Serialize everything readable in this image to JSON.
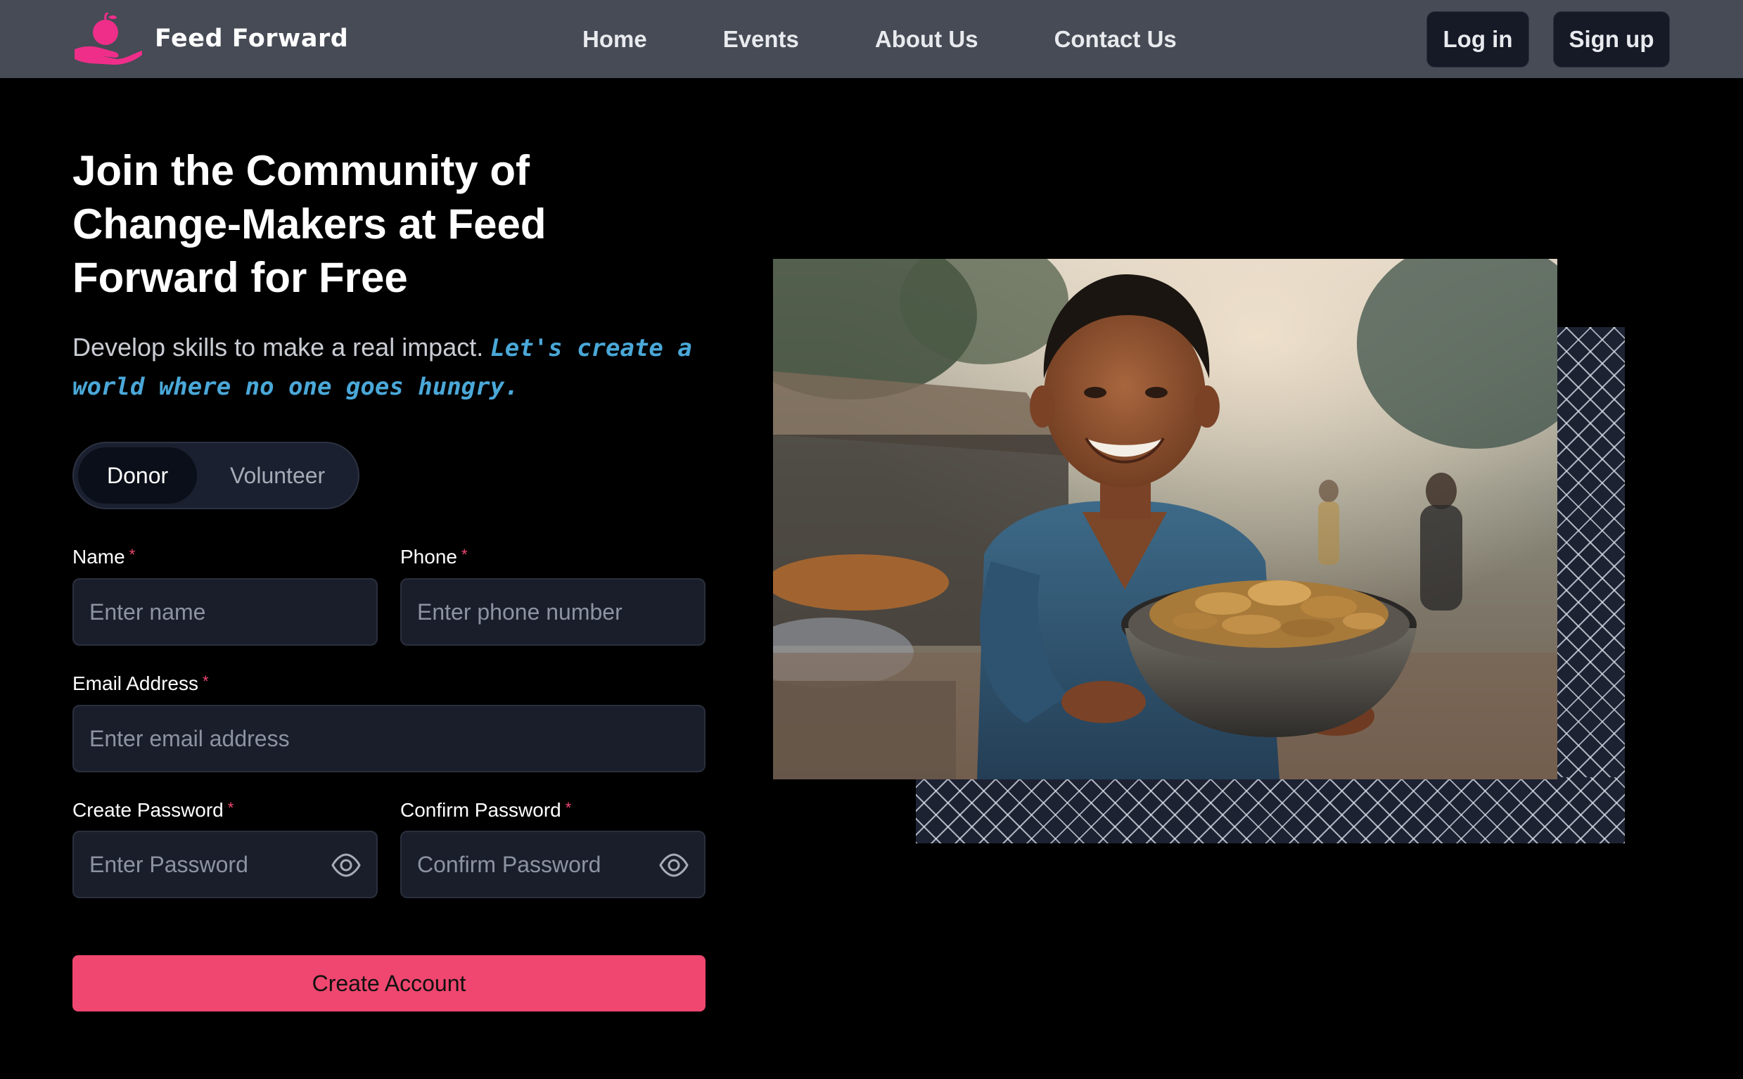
{
  "brand": {
    "name": "Feed Forward",
    "logo_icon": "hand-apple-icon",
    "logo_color": "#ef2e8a"
  },
  "nav": {
    "links": [
      {
        "label": "Home"
      },
      {
        "label": "Events"
      },
      {
        "label": "About Us"
      },
      {
        "label": "Contact Us"
      }
    ],
    "login_label": "Log in",
    "signup_label": "Sign up"
  },
  "hero": {
    "heading": "Join the Community of Change-Makers at Feed Forward for Free",
    "subtext_plain": "Develop skills to make a real impact.",
    "subtext_accent": "Let's create a world where no one goes hungry."
  },
  "role_toggle": {
    "options": [
      "Donor",
      "Volunteer"
    ],
    "selected": "Donor"
  },
  "form": {
    "name": {
      "label": "Name",
      "placeholder": "Enter name"
    },
    "phone": {
      "label": "Phone",
      "placeholder": "Enter phone number"
    },
    "email": {
      "label": "Email Address",
      "placeholder": "Enter email address"
    },
    "password": {
      "label": "Create Password",
      "placeholder": "Enter Password"
    },
    "confirm_password": {
      "label": "Confirm Password",
      "placeholder": "Confirm Password"
    },
    "required_mark": "*",
    "submit_label": "Create Account"
  },
  "colors": {
    "navbar_bg": "#464b55",
    "accent_pink": "#ef476f",
    "accent_blue": "#4aa8d8",
    "input_bg": "#1a1e2b"
  },
  "image": {
    "subject": "photo-child-holding-bowl-of-food"
  }
}
